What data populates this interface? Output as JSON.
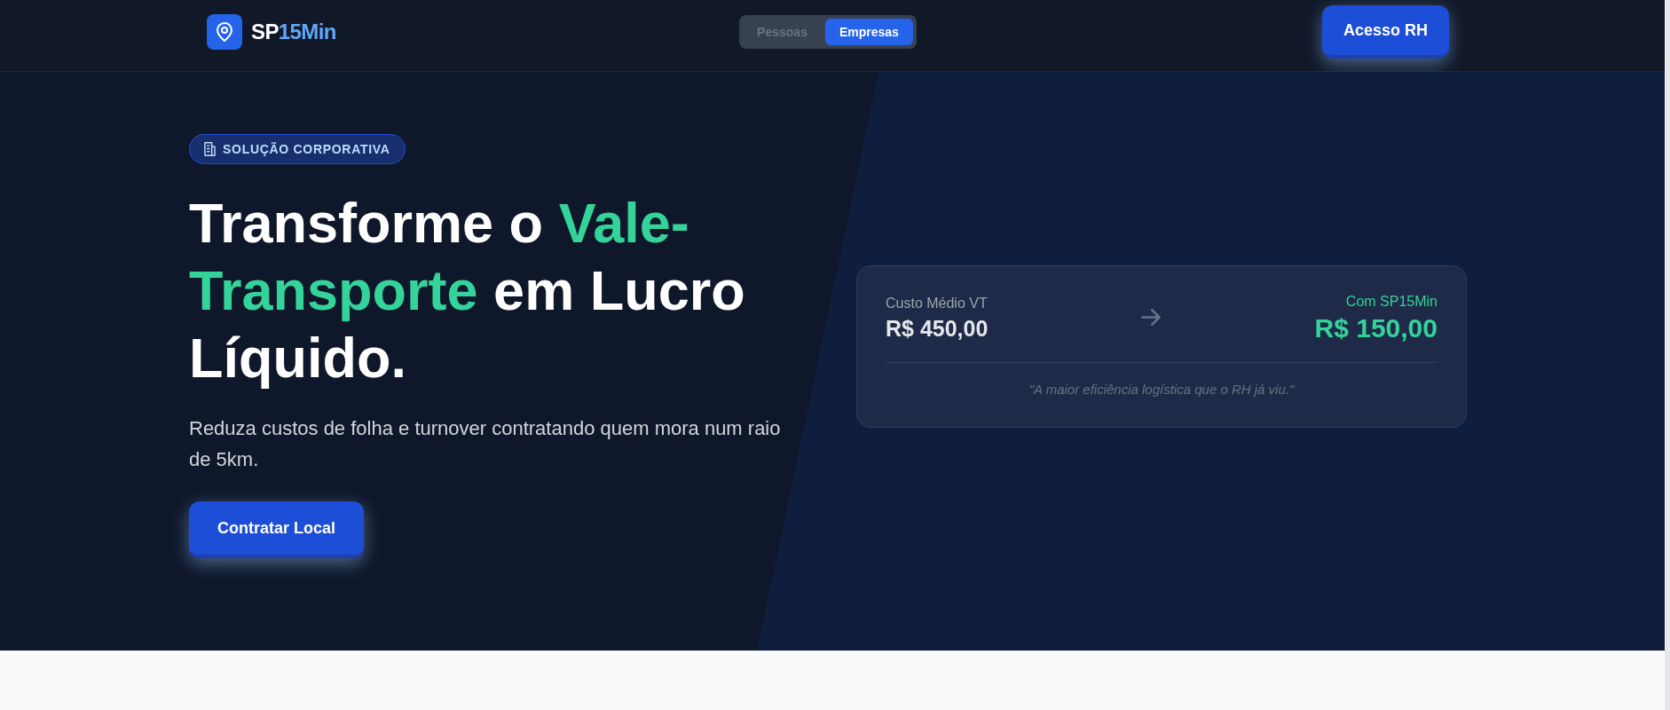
{
  "header": {
    "brand": {
      "text": "SP",
      "accent": "15Min"
    },
    "audience_tabs": [
      {
        "label": "Pessoas",
        "selected": false
      },
      {
        "label": "Empresas",
        "selected": true
      }
    ],
    "cta": "Acesso RH"
  },
  "hero": {
    "badge": "SOLUÇÃO CORPORATIVA",
    "title": [
      {
        "text": "Transforme o",
        "highlight": false
      },
      {
        "text": "Vale-Transporte",
        "highlight": true
      },
      {
        "text": "em Lucro Líquido.",
        "highlight": false
      }
    ],
    "subtitle": "Reduza custos de folha e turnover contratando quem mora num raio de 5km.",
    "cta": "Contratar Local",
    "comparison": {
      "before": {
        "label": "Custo Médio VT",
        "value": "R$ 450,00"
      },
      "after": {
        "label": "Com SP15Min",
        "value": "R$ 150,00"
      },
      "quote": "\"A maior eficiência logística que o RH já viu.\""
    }
  }
}
